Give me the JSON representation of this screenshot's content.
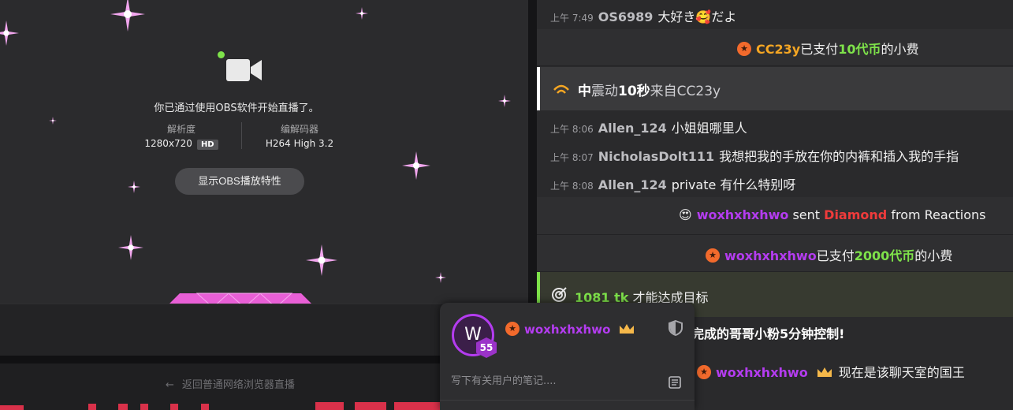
{
  "broadcast": {
    "live_message": "你已通过使用OBS软件开始直播了。",
    "resolution_label": "解析度",
    "resolution_value": "1280x720",
    "hd_badge": "HD",
    "codec_label": "编解码器",
    "codec_value": "H264 High 3.2",
    "obs_button": "显示OBS播放特性",
    "return_link": "返回普通网络浏览器直播",
    "accent_pink": "#e85fd6",
    "live_dot_color": "#7ee24a"
  },
  "chat": {
    "messages": [
      {
        "time": "上午 7:49",
        "user": "OS6989",
        "text": "大好き🥰だよ"
      },
      {
        "time": "上午 8:06",
        "user": "Allen_124",
        "text": "小姐姐哪里人"
      },
      {
        "time": "上午 8:07",
        "user": "NicholasDolt111",
        "text": "我想把我的手放在你的内裤和插入我的手指"
      },
      {
        "time": "上午 8:08",
        "user": "Allen_124",
        "text": "private 有什么特别呀"
      }
    ],
    "tip1": {
      "user": "CC23y",
      "pre": "已支付",
      "amount": "10代币",
      "post": "的小费"
    },
    "vibration": {
      "level": "中",
      "mid": "震动",
      "duration": "10秒",
      "from": "来自",
      "user": "CC23y"
    },
    "reaction": {
      "emoji": "😍",
      "user": "woxhxhxhwo",
      "sent": "sent",
      "item": "Diamond",
      "from": "from Reactions"
    },
    "tip2": {
      "user": "woxhxhxhwo",
      "pre": "已支付",
      "amount": "2000代币",
      "post": "的小费"
    },
    "goal": {
      "amount": "1081 tk",
      "text": "才能达成目标",
      "subtext": "完成的哥哥小粉5分钟控制!"
    },
    "king": {
      "user": "woxhxhxhwo",
      "text": "现在是该聊天室的国王"
    }
  },
  "popup": {
    "avatar_letter": "W",
    "level": "55",
    "username": "woxhxhxhwo",
    "note_placeholder": "写下有关用户的笔记....",
    "icons": [
      "coin-icon",
      "crown-icon",
      "shield-icon",
      "note-icon"
    ]
  }
}
